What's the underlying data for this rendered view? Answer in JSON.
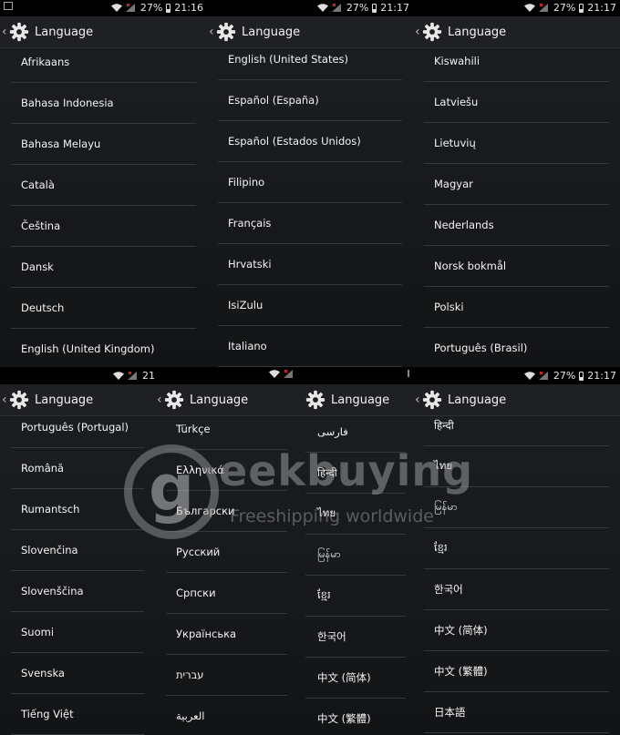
{
  "header_title": "Language",
  "status": {
    "s1": {
      "battery": "27%",
      "time": "21:16"
    },
    "s2": {
      "battery": "27%",
      "time": "21:17"
    },
    "s3": {
      "battery": "27%",
      "time": "21:17"
    },
    "s4": {
      "battery": "",
      "time": "21"
    },
    "s7": {
      "battery": "27%",
      "time": "21:17"
    }
  },
  "panels": {
    "p1": [
      "Afrikaans",
      "Bahasa Indonesia",
      "Bahasa Melayu",
      "Català",
      "Čeština",
      "Dansk",
      "Deutsch",
      "English (United Kingdom)"
    ],
    "p2": [
      "English (United States)",
      "Español (España)",
      "Español (Estados Unidos)",
      "Filipino",
      "Français",
      "Hrvatski",
      "IsiZulu",
      "Italiano"
    ],
    "p3": [
      "Kiswahili",
      "Latviešu",
      "Lietuvių",
      "Magyar",
      "Nederlands",
      "Norsk bokmål",
      "Polski",
      "Português (Brasil)"
    ],
    "p4": [
      "Português (Portugal)",
      "Română",
      "Rumantsch",
      "Slovenčina",
      "Slovenščina",
      "Suomi",
      "Svenska",
      "Tiếng Việt"
    ],
    "p5": [
      "Türkçe",
      "Ελληνικά",
      "Български",
      "Русский",
      "Српски",
      "Українська",
      "עברית",
      "العربية"
    ],
    "p6": [
      "فارسی",
      "हिन्दी",
      "ไทย",
      "မြန်မာ",
      "ខ្មែរ",
      "한국어",
      "中文 (简体)",
      "中文 (繁體)"
    ],
    "p7": [
      "हिन्दी",
      "ไทย",
      "မြန်မာ",
      "ខ្មែរ",
      "한국어",
      "中文 (简体)",
      "中文 (繁體)",
      "日本語"
    ]
  },
  "watermark": {
    "logo": "g",
    "word": "eekbuying",
    "tagline": "Freeshipping worldwide"
  }
}
